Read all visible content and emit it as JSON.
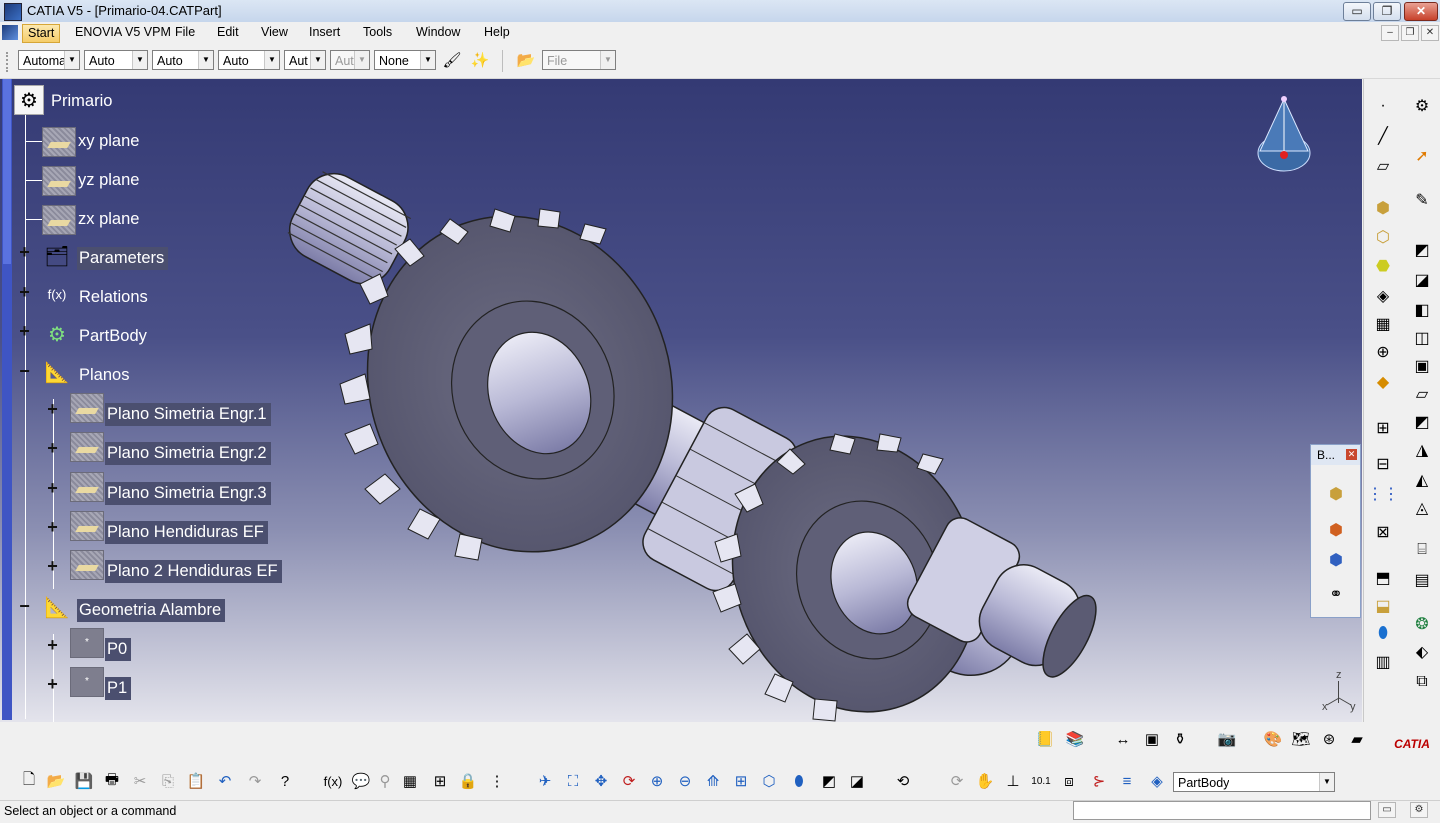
{
  "window": {
    "title": "CATIA V5 - [Primario-04.CATPart]",
    "minimize": "▭",
    "restore": "❐",
    "close": "✕"
  },
  "menu": {
    "items": [
      "Start",
      "ENOVIA V5 VPM",
      "File",
      "Edit",
      "View",
      "Insert",
      "Tools",
      "Window",
      "Help"
    ]
  },
  "toolbar": {
    "combos": [
      "Automa",
      "Auto",
      "Auto",
      "Auto",
      "Aut",
      "Aut",
      "None"
    ],
    "file_combo": "File"
  },
  "tree": {
    "root": "Primario",
    "nodes": [
      {
        "label": "xy plane"
      },
      {
        "label": "yz plane"
      },
      {
        "label": "zx plane"
      },
      {
        "label": "Parameters"
      },
      {
        "label": "Relations"
      },
      {
        "label": "PartBody"
      },
      {
        "label": "Planos"
      },
      {
        "label": "Plano Simetria Engr.1"
      },
      {
        "label": "Plano Simetria Engr.2"
      },
      {
        "label": "Plano Simetria Engr.3"
      },
      {
        "label": "Plano Hendiduras EF"
      },
      {
        "label": "Plano 2 Hendiduras EF"
      },
      {
        "label": "Geometria Alambre"
      },
      {
        "label": "P0"
      },
      {
        "label": "P1"
      }
    ]
  },
  "float_toolbar": {
    "title": "B..."
  },
  "axis": {
    "x": "x",
    "y": "y",
    "z": "z"
  },
  "bottom": {
    "current_body": "PartBody"
  },
  "status": {
    "message": "Select an object or a command"
  },
  "brand": {
    "logo": "CATIA"
  }
}
